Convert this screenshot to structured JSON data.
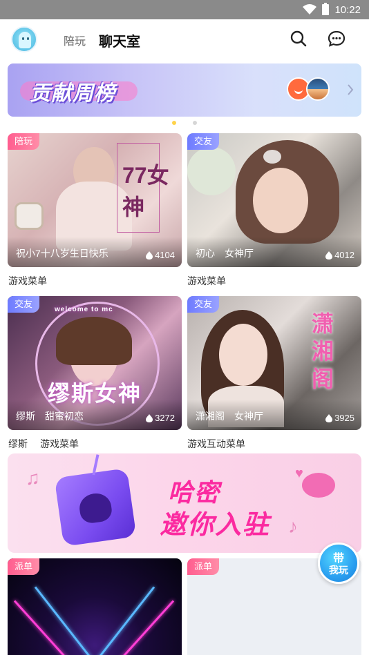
{
  "status_bar": {
    "time": "10:22"
  },
  "header": {
    "tabs": [
      {
        "label": "陪玩",
        "active": false
      },
      {
        "label": "聊天室",
        "active": true
      }
    ],
    "accent": "#ffd84a"
  },
  "banner": {
    "title": "贡献周榜",
    "pagination": {
      "count": 2,
      "active": 0
    }
  },
  "rooms": [
    {
      "tag": "陪玩",
      "room_name": "祝小7十八岁生日快乐",
      "hall": "",
      "heat": "4104",
      "label": [
        "游戏菜单"
      ]
    },
    {
      "tag": "交友",
      "room_name": "初心",
      "hall": "女神厅",
      "heat": "4012",
      "label": [
        "游戏菜单"
      ]
    },
    {
      "tag": "交友",
      "room_name": "缪斯",
      "hall": "甜蜜初恋",
      "heat": "3272",
      "label": [
        "缪斯",
        "游戏菜单"
      ]
    },
    {
      "tag": "交友",
      "room_name": "潇湘阁",
      "hall": "女神厅",
      "heat": "3925",
      "label": [
        "游戏互动菜单"
      ]
    },
    {
      "tag": "派单"
    },
    {
      "tag": "派单"
    }
  ],
  "card_art": {
    "card1_text": "77女神",
    "card3_text": "缪斯女神",
    "card3_subtext": "welcome to mc",
    "card4_text": "潇湘阁"
  },
  "promo": {
    "line1": "哈密",
    "line2": "邀你入驻"
  },
  "float_button": {
    "line1": "带",
    "line2": "我玩"
  }
}
